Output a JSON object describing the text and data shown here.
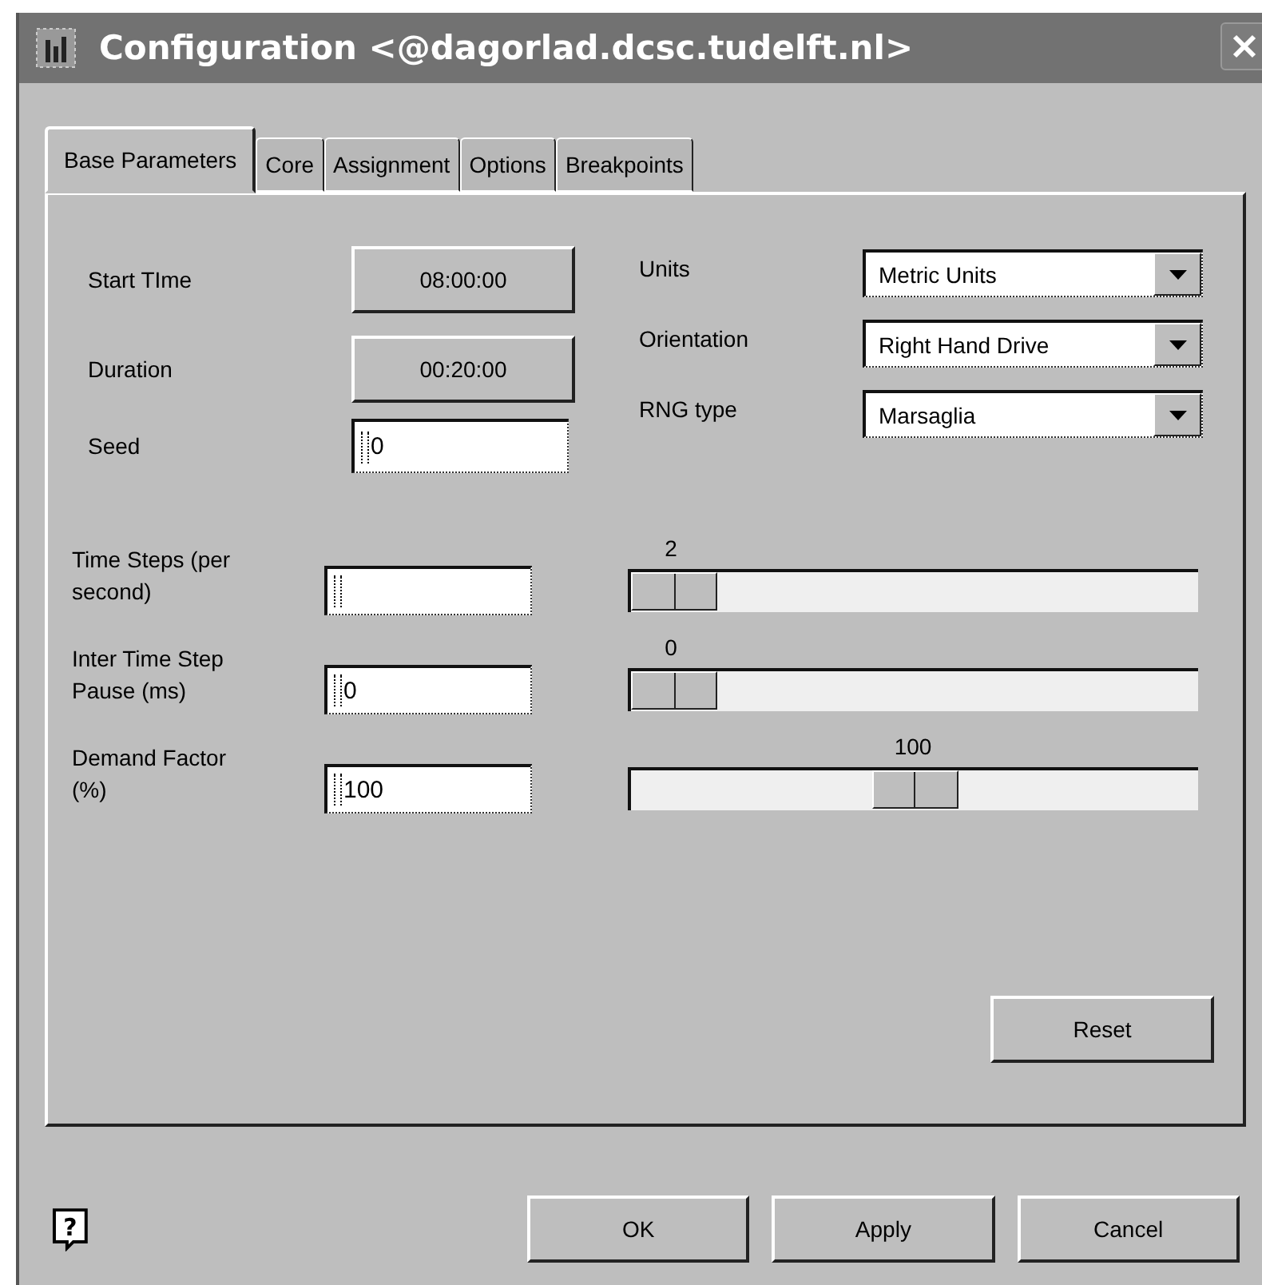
{
  "window": {
    "title": "Configuration <@dagorlad.dcsc.tudelft.nl>"
  },
  "tabs": [
    {
      "label": "Base Parameters",
      "selected": true
    },
    {
      "label": "Core",
      "selected": false
    },
    {
      "label": "Assignment",
      "selected": false
    },
    {
      "label": "Options",
      "selected": false
    },
    {
      "label": "Breakpoints",
      "selected": false
    }
  ],
  "time_fields": [
    {
      "label": "Start TIme",
      "value": "08:00:00"
    },
    {
      "label": "Duration",
      "value": "00:20:00"
    }
  ],
  "seed": {
    "label": "Seed",
    "value": "0"
  },
  "dropdowns": [
    {
      "label": "Units",
      "value": "Metric Units"
    },
    {
      "label": "Orientation",
      "value": "Right Hand Drive"
    },
    {
      "label": "RNG type",
      "value": "Marsaglia"
    }
  ],
  "sliders": [
    {
      "label": "Time Steps (per second)",
      "reading": "2",
      "level": 0
    },
    {
      "label": "Inter Time Step Pause (ms)",
      "value": "0",
      "reading": "0",
      "level": 0
    },
    {
      "label": "Demand Factor (%)",
      "value": "100",
      "reading": "100",
      "level": 0.5
    }
  ],
  "reset_button": "Reset",
  "help_button": "?",
  "buttons": [
    "OK",
    "Apply",
    "Cancel"
  ]
}
